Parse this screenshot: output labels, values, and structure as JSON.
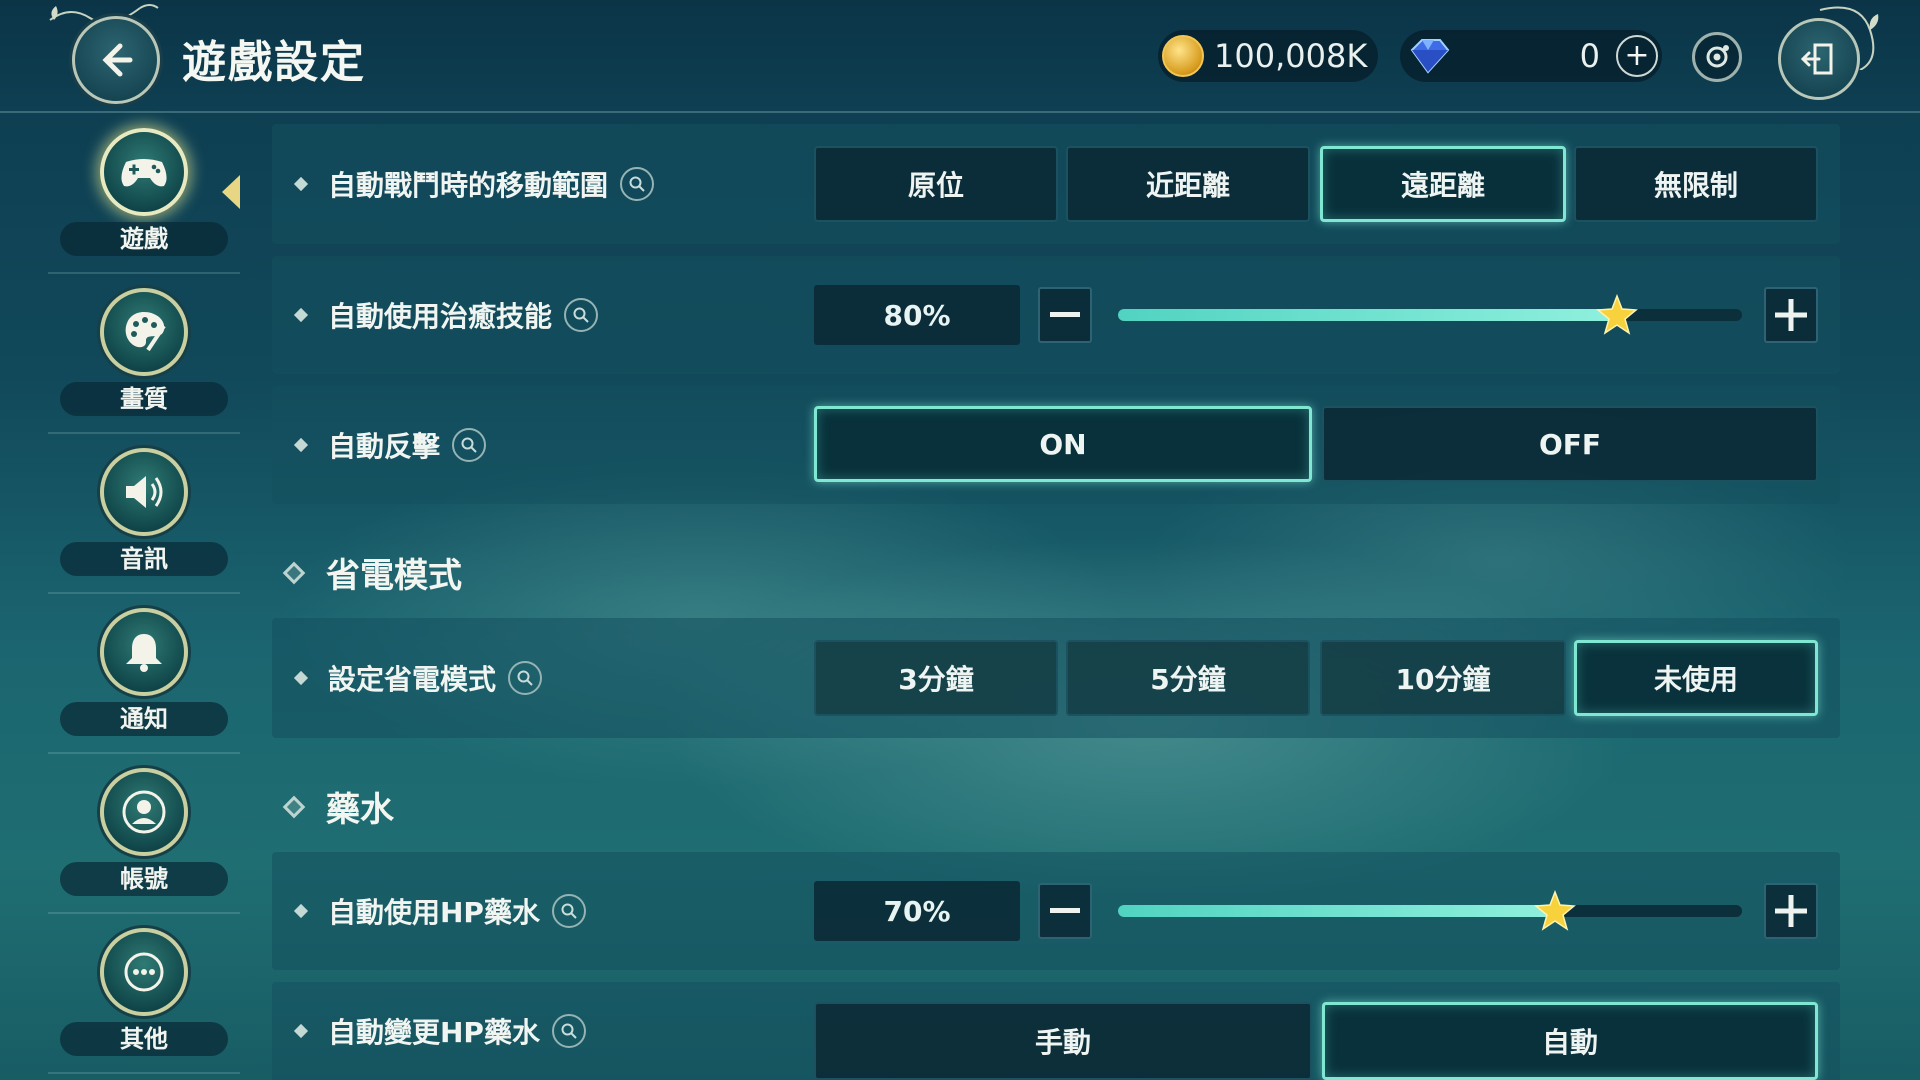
{
  "header": {
    "title": "遊戲設定",
    "gold": "100,008K",
    "gems": "0",
    "plus_symbol": "+"
  },
  "sidebar": {
    "items": [
      {
        "label": "遊戲",
        "icon": "gamepad-icon",
        "active": true
      },
      {
        "label": "畫質",
        "icon": "palette-icon",
        "active": false
      },
      {
        "label": "音訊",
        "icon": "speaker-icon",
        "active": false
      },
      {
        "label": "通知",
        "icon": "bell-icon",
        "active": false
      },
      {
        "label": "帳號",
        "icon": "user-icon",
        "active": false
      },
      {
        "label": "其他",
        "icon": "more-icon",
        "active": false
      }
    ]
  },
  "settings": {
    "move_range": {
      "label": "自動戰鬥時的移動範圍",
      "options": [
        "原位",
        "近距離",
        "遠距離",
        "無限制"
      ],
      "selected": "遠距離"
    },
    "auto_heal": {
      "label": "自動使用治癒技能",
      "value": "80%",
      "level": 0.8
    },
    "counter": {
      "label": "自動反擊",
      "options": [
        "ON",
        "OFF"
      ],
      "selected": "ON"
    },
    "power_section": "省電模式",
    "power_mode": {
      "label": "設定省電模式",
      "options": [
        "3分鐘",
        "5分鐘",
        "10分鐘",
        "未使用"
      ],
      "selected": "未使用"
    },
    "potion_section": "藥水",
    "auto_hp": {
      "label": "自動使用HP藥水",
      "value": "70%",
      "level": 0.7
    },
    "change_hp": {
      "label": "自動變更HP藥水",
      "options": [
        "手動",
        "自動"
      ],
      "selected": "自動"
    }
  },
  "colors": {
    "accent": "#7fe7d2",
    "slider_fill": "#51d3c1",
    "star": "#f7d23c"
  }
}
